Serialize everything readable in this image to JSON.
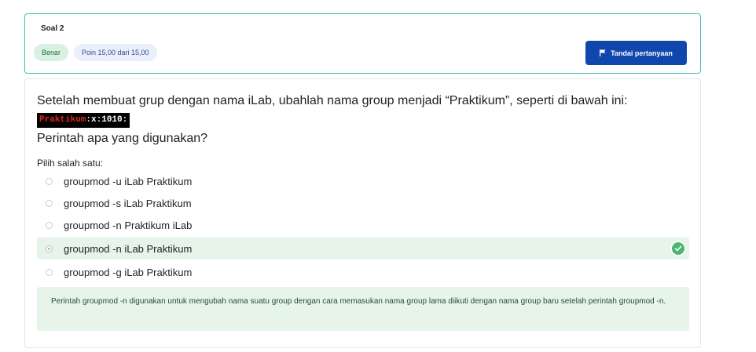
{
  "question": {
    "number_label": "Soal 2",
    "state_badge": "Benar",
    "grade_badge": "Poin 15,00 dari 15,00",
    "flag_button_label": "Tandai pertanyaan",
    "text_line1": "Setelah membuat grup dengan nama iLab, ubahlah nama group menjadi “Praktikum”, seperti di bawah ini:",
    "code_highlight": "Praktikum",
    "code_rest": ":x:1010:",
    "text_line2": "Perintah apa yang digunakan?",
    "prompt": "Pilih salah satu:",
    "options": [
      {
        "label": "groupmod -u iLab Praktikum",
        "selected": false,
        "correct": false
      },
      {
        "label": "groupmod -s iLab Praktikum",
        "selected": false,
        "correct": false
      },
      {
        "label": "groupmod -n Praktikum iLab",
        "selected": false,
        "correct": false
      },
      {
        "label": "groupmod -n iLab Praktikum",
        "selected": true,
        "correct": true
      },
      {
        "label": "groupmod -g iLab Praktikum",
        "selected": false,
        "correct": false
      }
    ],
    "feedback": "Perintah groupmod -n digunakan untuk mengubah nama suatu group dengan cara memasukan nama group lama diikuti dengan nama group baru setelah perintah groupmod -n."
  },
  "colors": {
    "accent_border": "#3ebfb3",
    "primary_button": "#0f47ad",
    "correct_bg": "#e6f4ea",
    "correct_icon": "#4fb46f",
    "code_highlight": "#e0261f"
  },
  "icons": {
    "flag": "flag-icon",
    "correct": "check-circle-icon"
  }
}
